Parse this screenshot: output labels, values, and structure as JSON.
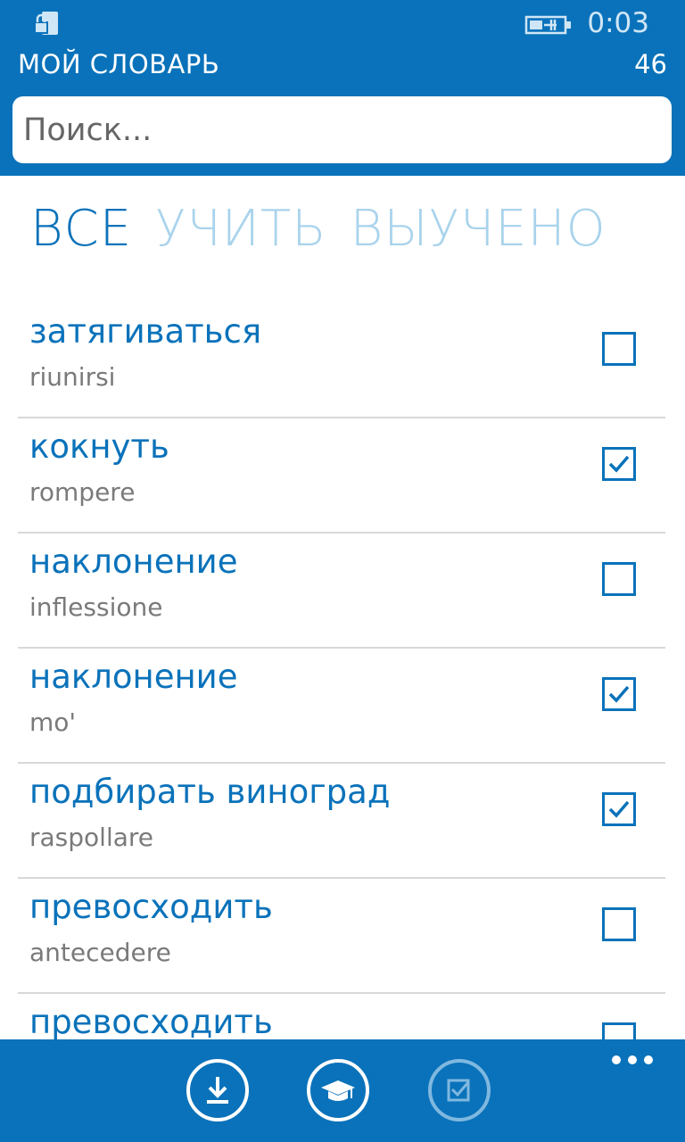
{
  "status_bar": {
    "time": "0:03"
  },
  "header": {
    "title": "МОЙ СЛОВАРЬ",
    "count": "46"
  },
  "search": {
    "placeholder": "Поиск..."
  },
  "tabs": [
    {
      "label": "ВСЕ",
      "active": true
    },
    {
      "label": "УЧИТЬ",
      "active": false
    },
    {
      "label": "ВЫУЧЕНО",
      "active": false
    }
  ],
  "words": [
    {
      "word": "затягиваться",
      "translation": "riunirsi",
      "checked": false
    },
    {
      "word": "кокнуть",
      "translation": "rompere",
      "checked": true
    },
    {
      "word": "наклонение",
      "translation": "inflessione",
      "checked": false
    },
    {
      "word": "наклонение",
      "translation": "mo'",
      "checked": true
    },
    {
      "word": "подбирать виноград",
      "translation": "raspollare",
      "checked": true
    },
    {
      "word": "превосходить",
      "translation": "antecedere",
      "checked": false
    },
    {
      "word": "превосходить",
      "translation": "",
      "checked": false
    }
  ],
  "app_bar": {
    "buttons": [
      {
        "icon": "download-icon"
      },
      {
        "icon": "graduation-cap-icon"
      },
      {
        "icon": "checkbox-icon",
        "disabled": true
      }
    ],
    "more_icon": "more-dots-icon"
  },
  "colors": {
    "accent": "#0a72ba",
    "tab_inactive": "#a9d3ec",
    "translation_text": "#7a7a7a"
  }
}
